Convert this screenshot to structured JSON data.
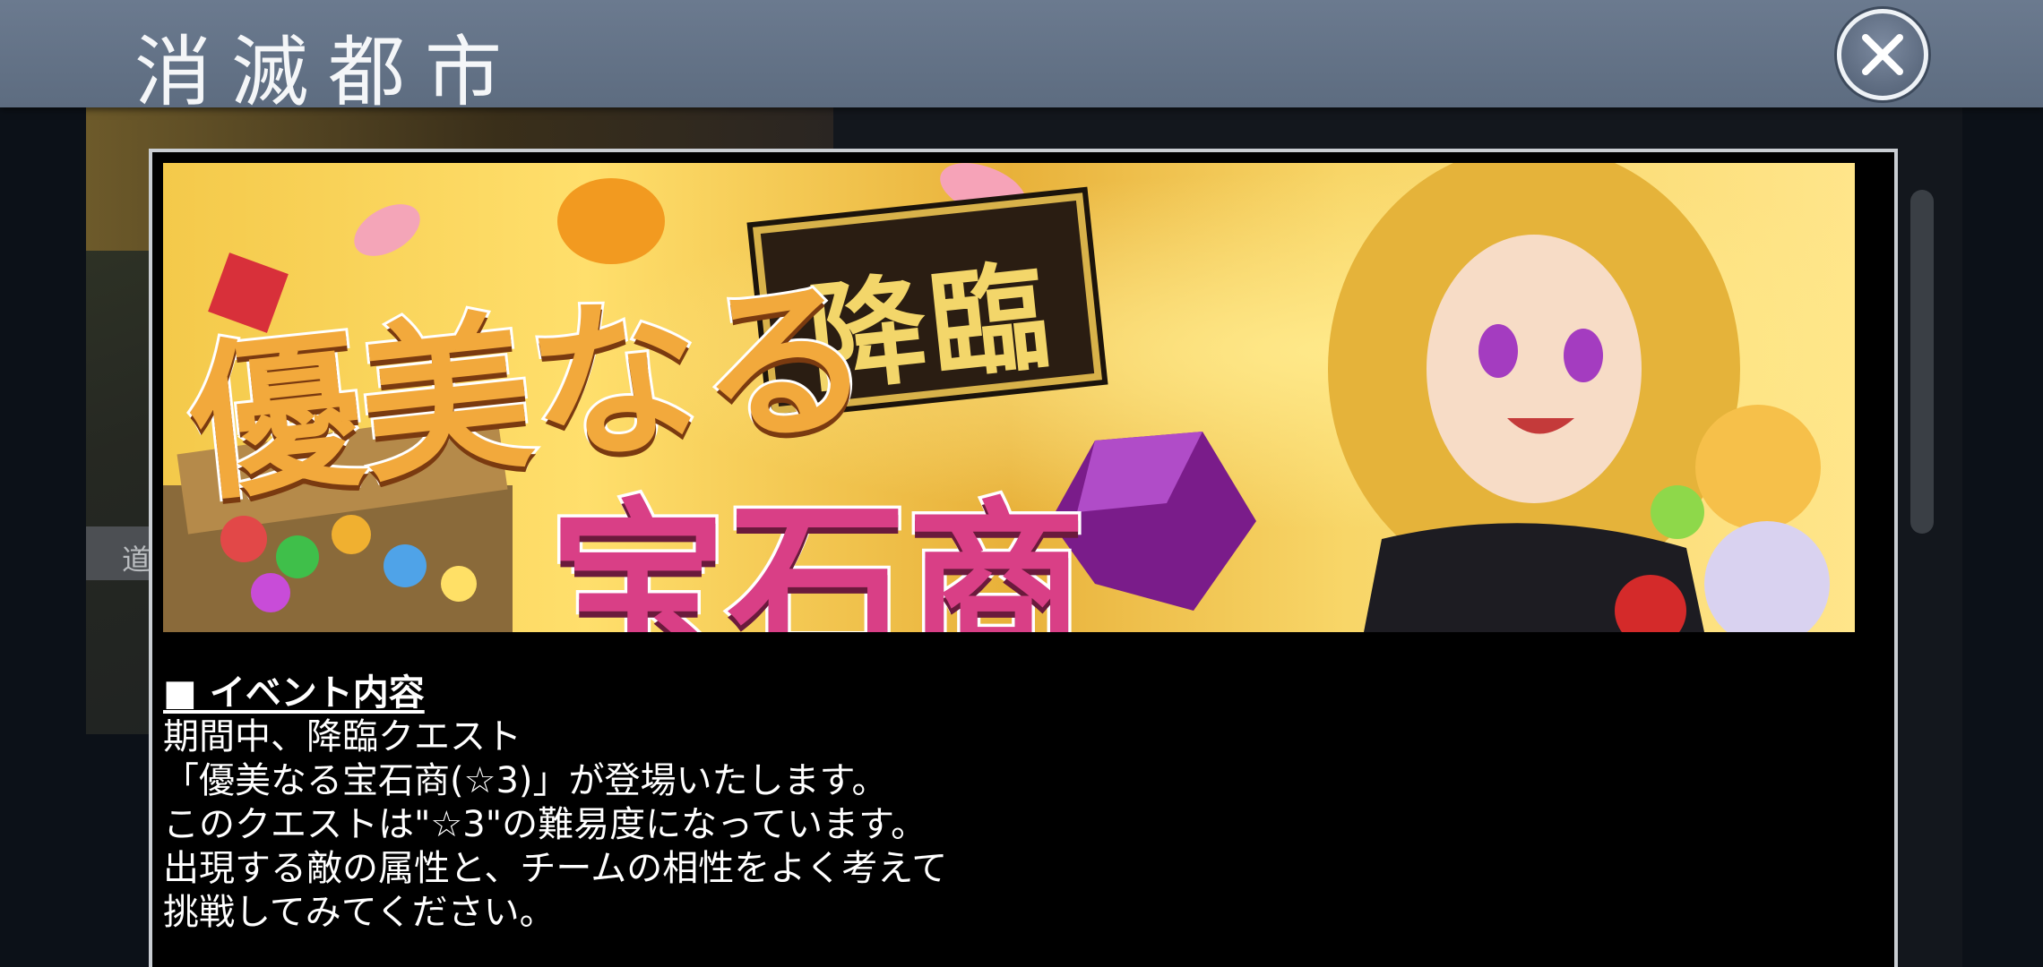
{
  "window": {
    "title": "消滅都市"
  },
  "background": {
    "strip_text": "道"
  },
  "modal": {
    "banner": {
      "badge": "降臨",
      "title_line1": "優美なる",
      "title_line2": "宝石商"
    },
    "section_heading": "■ イベント内容",
    "body_lines": [
      "期間中、降臨クエスト",
      "「優美なる宝石商(☆3)」が登場いたします。",
      "このクエストは\"☆3\"の難易度になっています。",
      "出現する敵の属性と、チームの相性をよく考えて",
      "挑戦してみてください。"
    ]
  },
  "icons": {
    "close": "close-icon"
  },
  "colors": {
    "title_bar": "#6b7a8f",
    "modal_bg": "#000000",
    "modal_border": "#c9cdd2"
  }
}
